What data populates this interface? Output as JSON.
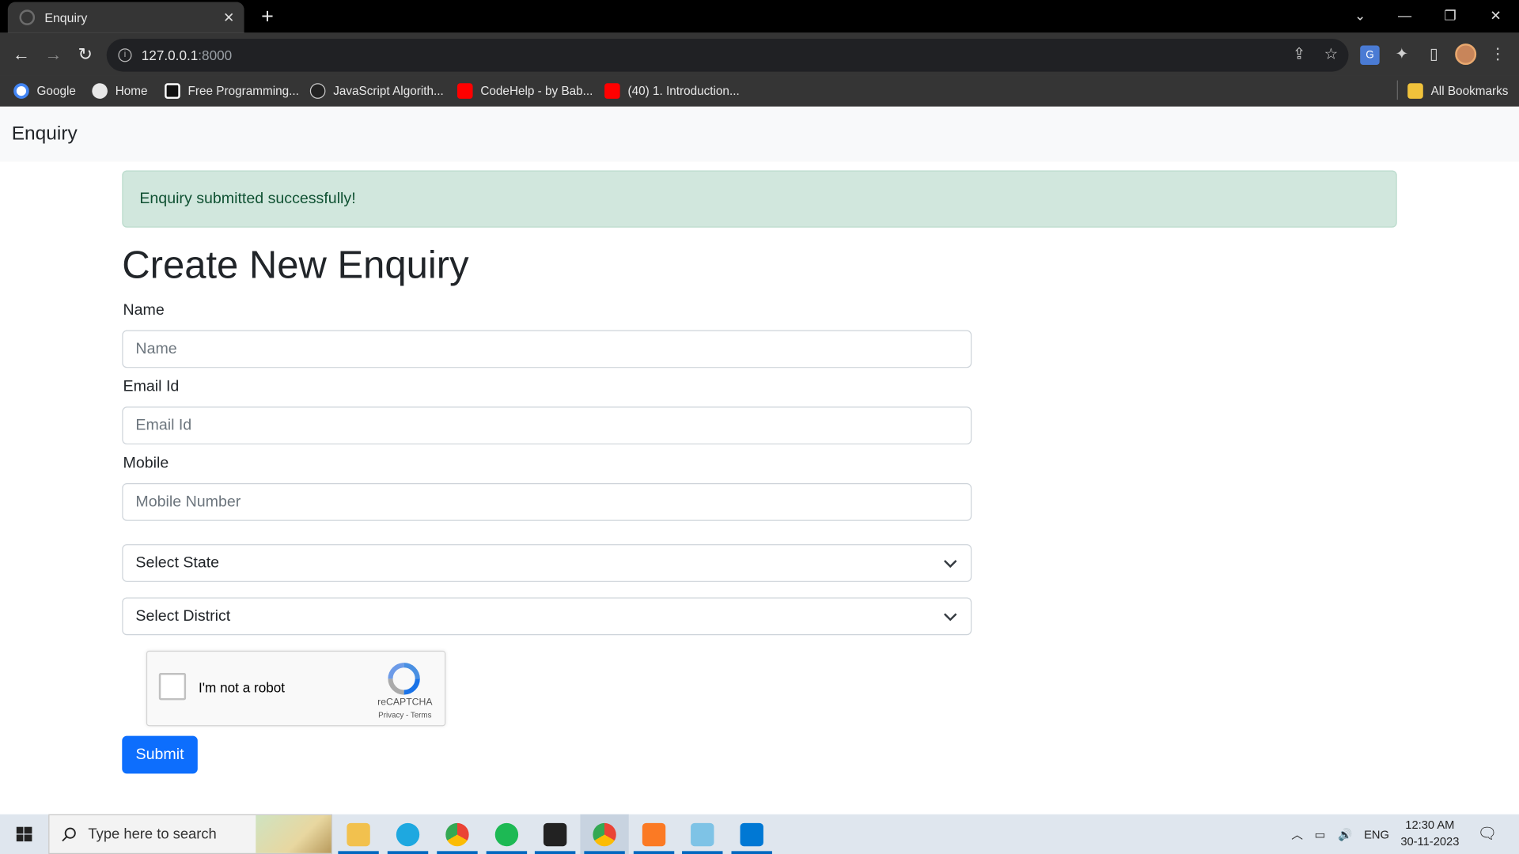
{
  "browser": {
    "tab_title": "Enquiry",
    "url_host": "127.0.0.1",
    "url_port": ":8000",
    "bookmarks": [
      {
        "label": "Google",
        "color": "#4285f4"
      },
      {
        "label": "Home",
        "color": "#e8e8e8"
      },
      {
        "label": "Free Programming...",
        "color": "#ffffff"
      },
      {
        "label": "JavaScript Algorith...",
        "color": "#cccccc"
      },
      {
        "label": "CodeHelp - by Bab...",
        "color": "#ff0000"
      },
      {
        "label": "(40) 1. Introduction...",
        "color": "#ff0000"
      }
    ],
    "all_bookmarks_label": "All Bookmarks"
  },
  "navbar": {
    "brand": "Enquiry"
  },
  "alert": {
    "message": "Enquiry submitted successfully!",
    "background": "#d1e7dd",
    "text_color": "#0f5132"
  },
  "form": {
    "heading": "Create New Enquiry",
    "name_label": "Name",
    "name_placeholder": "Name",
    "email_label": "Email Id",
    "email_placeholder": "Email Id",
    "mobile_label": "Mobile",
    "mobile_placeholder": "Mobile Number",
    "state_select": "Select State",
    "district_select": "Select District",
    "submit_label": "Submit",
    "submit_color": "#0d6efd"
  },
  "recaptcha": {
    "checkbox_label": "I'm not a robot",
    "brand": "reCAPTCHA",
    "links": "Privacy - Terms"
  },
  "taskbar": {
    "search_placeholder": "Type here to search",
    "apps": [
      "file-explorer-icon",
      "edge-icon",
      "chrome-icon",
      "spotify-icon",
      "terminal-icon",
      "chrome-profile-icon",
      "xampp-icon",
      "notepad-icon",
      "vscode-icon"
    ],
    "language": "ENG",
    "time": "12:30 AM",
    "date": "30-11-2023"
  }
}
